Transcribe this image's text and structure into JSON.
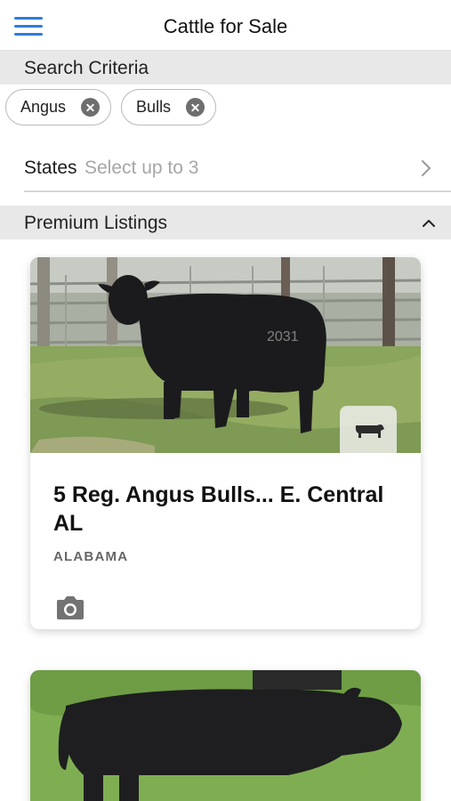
{
  "nav": {
    "title": "Cattle for Sale",
    "menu_icon": "hamburger-menu-icon"
  },
  "search": {
    "header": "Search Criteria",
    "chips": [
      {
        "label": "Angus",
        "icon": "close-circle-icon"
      },
      {
        "label": "Bulls",
        "icon": "close-circle-icon"
      }
    ],
    "states": {
      "label": "States",
      "placeholder": "Select up to 3",
      "icon": "chevron-right-icon"
    }
  },
  "premium": {
    "header": "Premium Listings",
    "collapse_icon": "chevron-up-icon",
    "listings": [
      {
        "title": "5 Reg. Angus Bulls... E. Central AL",
        "state": "ALABAMA",
        "badge_icon": "cow-silhouette-icon",
        "photos_icon": "camera-icon"
      }
    ]
  },
  "colors": {
    "accent": "#2f7dd8",
    "section_bg": "#e8e8e8",
    "placeholder": "#a6a6a6"
  }
}
